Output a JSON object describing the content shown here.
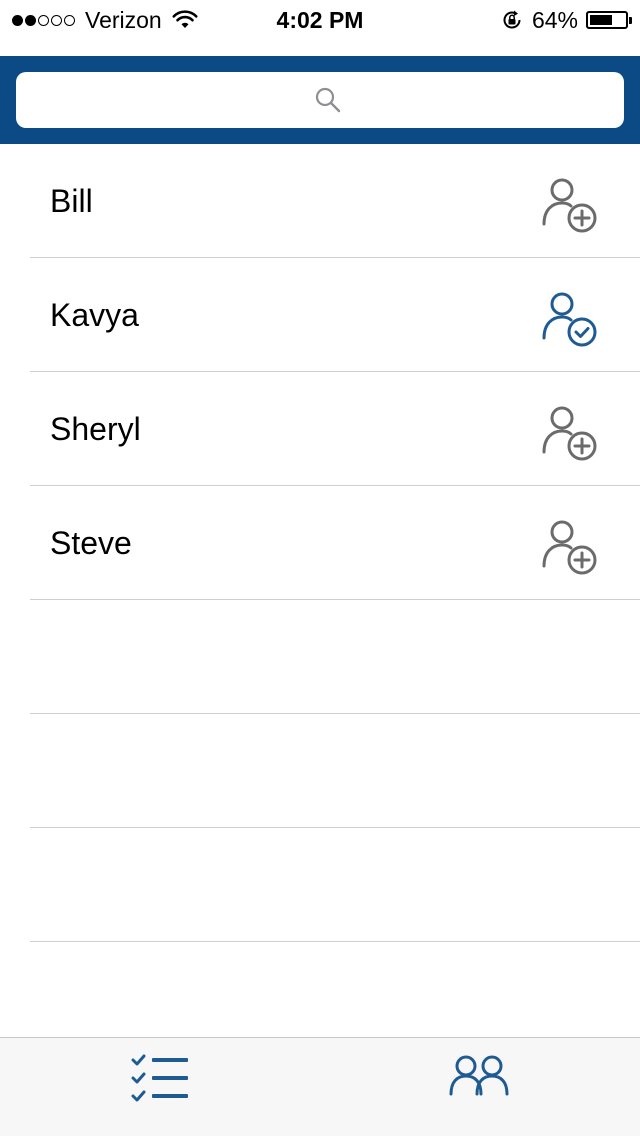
{
  "status_bar": {
    "carrier": "Verizon",
    "time": "4:02 PM",
    "battery_percent": "64%",
    "battery_level": 0.64,
    "signal_strength": 2,
    "signal_max": 5
  },
  "search": {
    "placeholder": "",
    "value": ""
  },
  "contacts": [
    {
      "name": "Bill",
      "status": "add"
    },
    {
      "name": "Kavya",
      "status": "added"
    },
    {
      "name": "Sheryl",
      "status": "add"
    },
    {
      "name": "Steve",
      "status": "add"
    }
  ],
  "tab_bar": {
    "tabs": [
      {
        "icon": "checklist-icon",
        "selected": false
      },
      {
        "icon": "people-icon",
        "selected": true
      }
    ]
  },
  "colors": {
    "header": "#0c4a86",
    "accent": "#1f5b93",
    "icon_gray": "#6b6b6b",
    "divider": "#cfcfcf"
  }
}
